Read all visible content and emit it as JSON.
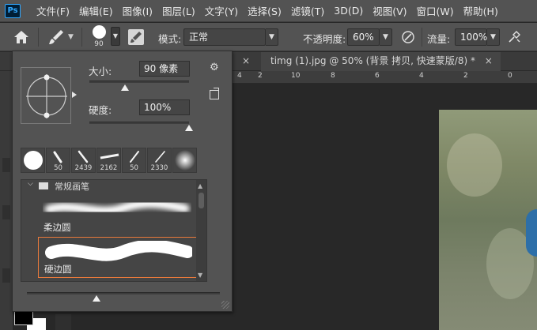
{
  "app": {
    "logo": "Ps"
  },
  "menu": [
    "文件(F)",
    "编辑(E)",
    "图像(I)",
    "图层(L)",
    "文字(Y)",
    "选择(S)",
    "滤镜(T)",
    "3D(D)",
    "视图(V)",
    "窗口(W)",
    "帮助(H)"
  ],
  "options": {
    "brush_size": "90",
    "mode_label": "模式:",
    "mode_value": "正常",
    "opacity_label": "不透明度:",
    "opacity_value": "60%",
    "flow_label": "流量:",
    "flow_value": "100%"
  },
  "tabs": {
    "hidden_close": "×",
    "active": "timg (1).jpg @ 50% (背景 拷贝, 快速蒙版/8) *",
    "active_close": "×"
  },
  "ruler": {
    "labels": [
      "4",
      "2",
      "10",
      "8",
      "6",
      "4",
      "2",
      "0"
    ]
  },
  "brush_panel": {
    "size_label": "大小:",
    "size_value": "90 像素",
    "size_slider": 0.36,
    "hardness_label": "硬度:",
    "hardness_value": "100%",
    "hardness_slider": 1.0,
    "recent_brushes": [
      {
        "icon": "round-hard-icon",
        "size": ""
      },
      {
        "icon": "stroke-brush-icon",
        "size": "50"
      },
      {
        "icon": "stroke-brush-icon",
        "size": "2439"
      },
      {
        "icon": "flat-brush-icon",
        "size": "2162"
      },
      {
        "icon": "stroke-brush-icon",
        "size": "50"
      },
      {
        "icon": "stroke-brush-icon",
        "size": "2330"
      },
      {
        "icon": "round-soft-icon",
        "size": ""
      }
    ],
    "group_name": "常规画笔",
    "presets": [
      {
        "name": "柔边圆",
        "style": "soft",
        "selected": false
      },
      {
        "name": "硬边圆",
        "style": "hard",
        "selected": true
      }
    ],
    "preview_slider": 0.36
  }
}
